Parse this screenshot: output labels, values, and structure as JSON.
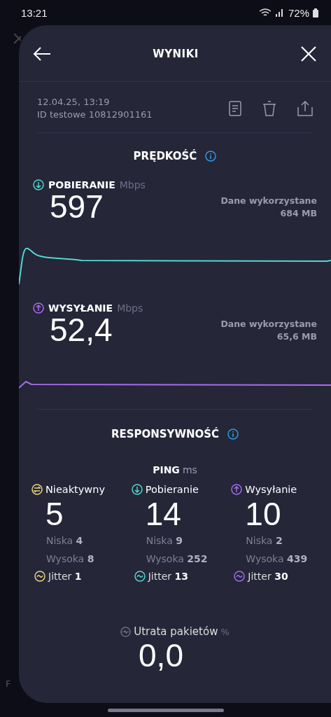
{
  "status_bar": {
    "time": "13:21",
    "battery": "72%"
  },
  "background": {
    "fragment": "F"
  },
  "header": {
    "title": "WYNIKI"
  },
  "test_info": {
    "date": "12.04.25, 13:19",
    "test_id": "ID testowe 10812901161"
  },
  "speed": {
    "title": "PRĘDKOŚĆ",
    "metrics": [
      {
        "kind": "download",
        "label": "POBIERANIE",
        "unit": "Mbps",
        "value": "597",
        "data_label": "Dane wykorzystane",
        "data_value": "684 MB"
      },
      {
        "kind": "upload",
        "label": "WYSYŁANIE",
        "unit": "Mbps",
        "value": "52,4",
        "data_label": "Dane wykorzystane",
        "data_value": "65,6 MB"
      }
    ]
  },
  "responsiveness": {
    "title": "RESPONSYWNOŚĆ",
    "ping_label": "PING",
    "ping_unit": "ms",
    "columns": [
      {
        "kind": "idle",
        "label": "Nieaktywny",
        "value": "5",
        "low_label": "Niska",
        "low": "4",
        "high_label": "Wysoka",
        "high": "8",
        "jitter_label": "Jitter",
        "jitter": "1"
      },
      {
        "kind": "download",
        "label": "Pobieranie",
        "value": "14",
        "low_label": "Niska",
        "low": "9",
        "high_label": "Wysoka",
        "high": "252",
        "jitter_label": "Jitter",
        "jitter": "13"
      },
      {
        "kind": "upload",
        "label": "Wysyłanie",
        "value": "10",
        "low_label": "Niska",
        "low": "2",
        "high_label": "Wysoka",
        "high": "439",
        "jitter_label": "Jitter",
        "jitter": "30"
      }
    ]
  },
  "packet_loss": {
    "label": "Utrata pakietów",
    "unit": "%",
    "value": "0,0"
  }
}
